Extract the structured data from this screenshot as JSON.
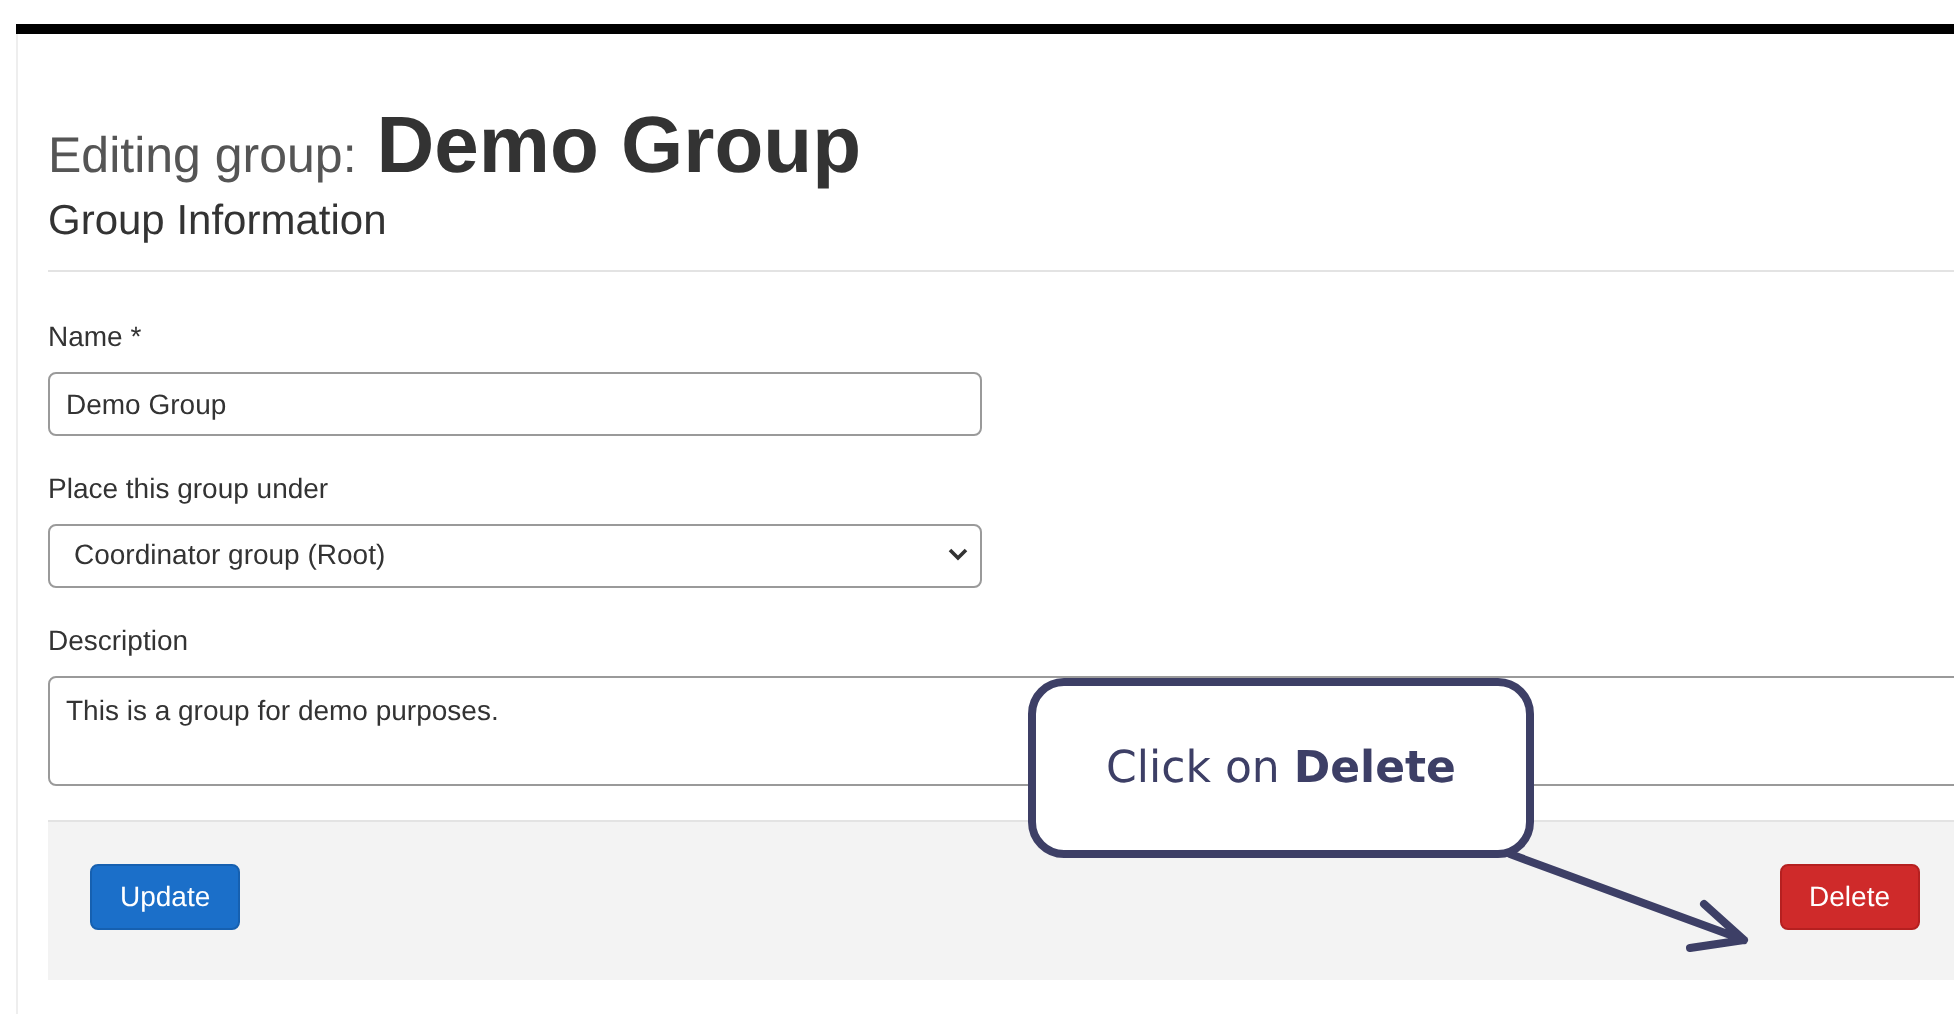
{
  "heading": {
    "prefix": "Editing group:",
    "group_name": "Demo Group"
  },
  "section_title": "Group Information",
  "fields": [
    {
      "kind": "text",
      "label": "Name *",
      "value": "Demo Group"
    },
    {
      "kind": "select",
      "label": "Place this group under",
      "value": "Coordinator group (Root)"
    },
    {
      "kind": "textarea",
      "label": "Description",
      "value": "This is a group for demo purposes."
    }
  ],
  "buttons": [
    {
      "label": "Update",
      "kind": "primary"
    },
    {
      "label": "Delete",
      "kind": "danger"
    }
  ],
  "callout": {
    "text": "Click on **Delete**"
  }
}
